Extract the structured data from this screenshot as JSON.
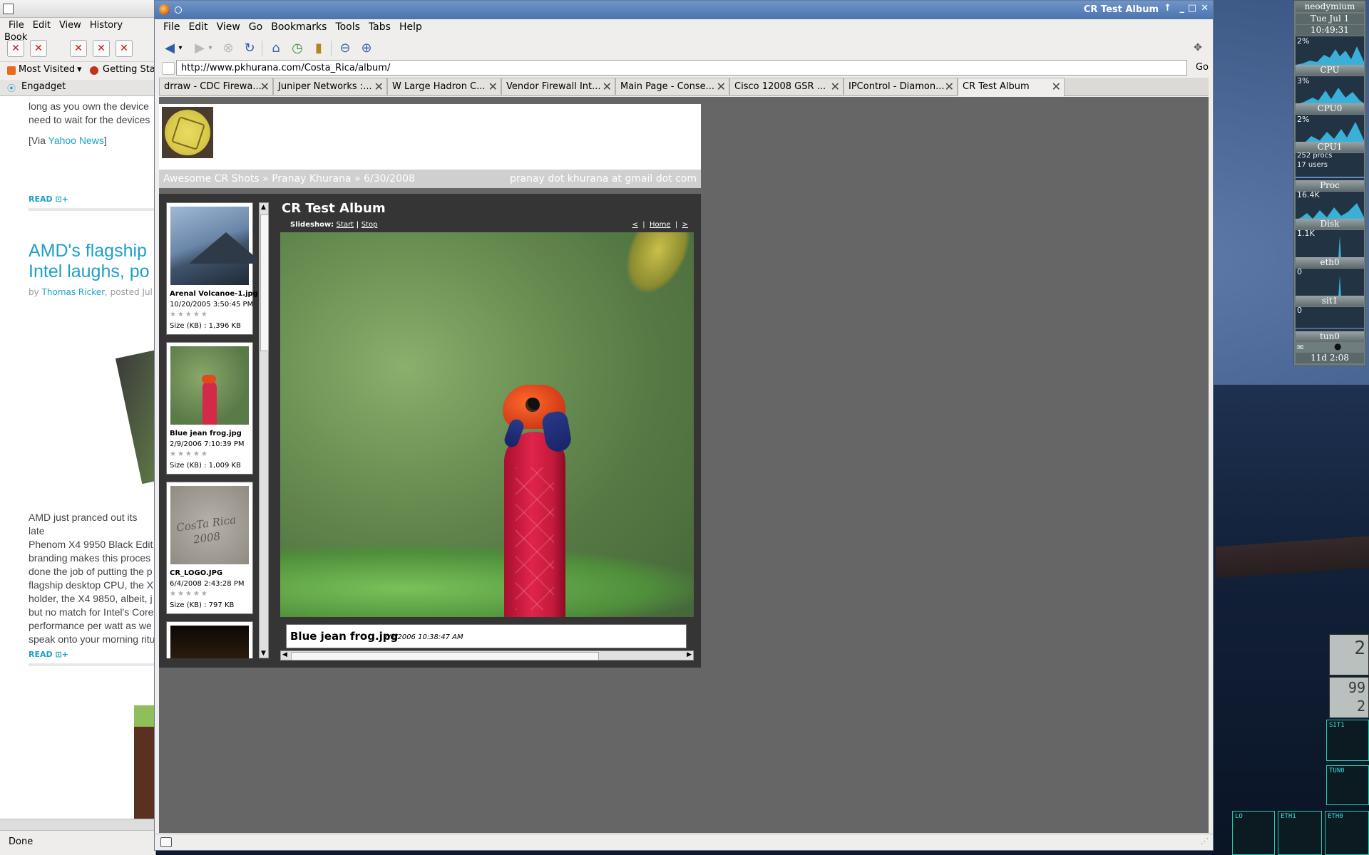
{
  "back_window": {
    "menu": [
      "File",
      "Edit",
      "View",
      "History",
      "Book"
    ],
    "bookmarks": [
      "Most Visited",
      "Getting Sta"
    ],
    "tab": "Engadget",
    "snippet": [
      "long as you own the device",
      "need to wait for the devices"
    ],
    "via_prefix": "[Via ",
    "via_link": "Yahoo News",
    "via_suffix": "]",
    "read_more": "READ",
    "headline_1": "AMD's flagship",
    "headline_2": "Intel laughs, po",
    "byline_prefix": "by ",
    "byline_author": "Thomas Ricker",
    "byline_suffix": ", posted Jul",
    "body": [
      "AMD just pranced out its late",
      "Phenom X4 9950 Black Edit",
      "branding makes this proces",
      "done the job of putting the p",
      "flagship desktop CPU, the X",
      "holder, the X4 9850, albeit, j",
      "but no match for Intel's Core",
      "performance per watt as we",
      "speak onto your morning ritu"
    ],
    "read_more_2": "READ",
    "status": "Done"
  },
  "window": {
    "title": "CR Test Album",
    "controls": [
      "↑",
      "_",
      "□",
      "✕"
    ],
    "menu": [
      {
        "label": "File",
        "key": "F"
      },
      {
        "label": "Edit",
        "key": "E"
      },
      {
        "label": "View",
        "key": "V"
      },
      {
        "label": "Go",
        "key": "G"
      },
      {
        "label": "Bookmarks",
        "key": "B"
      },
      {
        "label": "Tools",
        "key": "T"
      },
      {
        "label": "Tabs",
        "key": "T"
      },
      {
        "label": "Help",
        "key": "H"
      }
    ],
    "url": "http://www.pkhurana.com/Costa_Rica/album/",
    "go_label": "Go",
    "tabs": [
      {
        "label": "drraw - CDC Firewa..."
      },
      {
        "label": "Juniper Networks :..."
      },
      {
        "label": "W Large Hadron C..."
      },
      {
        "label": "Vendor Firewall Int..."
      },
      {
        "label": "Main Page - Conse..."
      },
      {
        "label": "Cisco 12008 GSR ..."
      },
      {
        "label": "IPControl - Diamon..."
      },
      {
        "label": "CR Test Album"
      }
    ]
  },
  "page": {
    "breadcrumbs": [
      "Awesome CR Shots",
      "»",
      "Pranay Khurana",
      "»",
      "6/30/2008"
    ],
    "contact": "pranay dot khurana at gmail dot com",
    "album_title": "CR Test Album",
    "slideshow_label": "Slideshow:",
    "slideshow_start": "Start",
    "slideshow_sep": "|",
    "slideshow_stop": "Stop",
    "nav_prev": "<",
    "nav_home": "Home",
    "nav_next": ">",
    "nav_sep": "|",
    "size_label": "Size (KB)",
    "thumbnails": [
      {
        "name": "Arenal Volcanoe-1.jpg",
        "date": "10/20/2005 3:50:45 PM",
        "size": "1,396 KB",
        "stars": "★★★★★"
      },
      {
        "name": "Blue jean frog.jpg",
        "date": "2/9/2006 7:10:39 PM",
        "size": "1,009 KB",
        "stars": "★★★★★"
      },
      {
        "name": "CR_LOGO.JPG",
        "date": "6/4/2008 2:43:28 PM",
        "size": "797 KB",
        "stars": "★★★★★"
      }
    ],
    "caption_name": "Blue jean frog.jpg",
    "caption_date": "2/8/2006 10:38:47 AM"
  },
  "gkrellm": {
    "host": "neodymium",
    "date": "Tue Jul  1",
    "time": "10:49:31",
    "cpu_pct": [
      "2%",
      "3%",
      "2%"
    ],
    "bands": [
      "CPU",
      "CPU0",
      "CPU1",
      "Proc",
      "Disk",
      "eth0",
      "sit1",
      "tun0"
    ],
    "procs": "252 procs",
    "users": "17 users",
    "disk_val": "16.4K",
    "eth_val": "1.1K",
    "sit_val": "0",
    "tun_val": "0",
    "uptime": "11d  2:08",
    "meters": [
      "2",
      "99",
      "2"
    ],
    "net_labels": [
      "SIT1",
      "TUN0",
      "LO",
      "ETH1",
      "ETH0"
    ]
  }
}
